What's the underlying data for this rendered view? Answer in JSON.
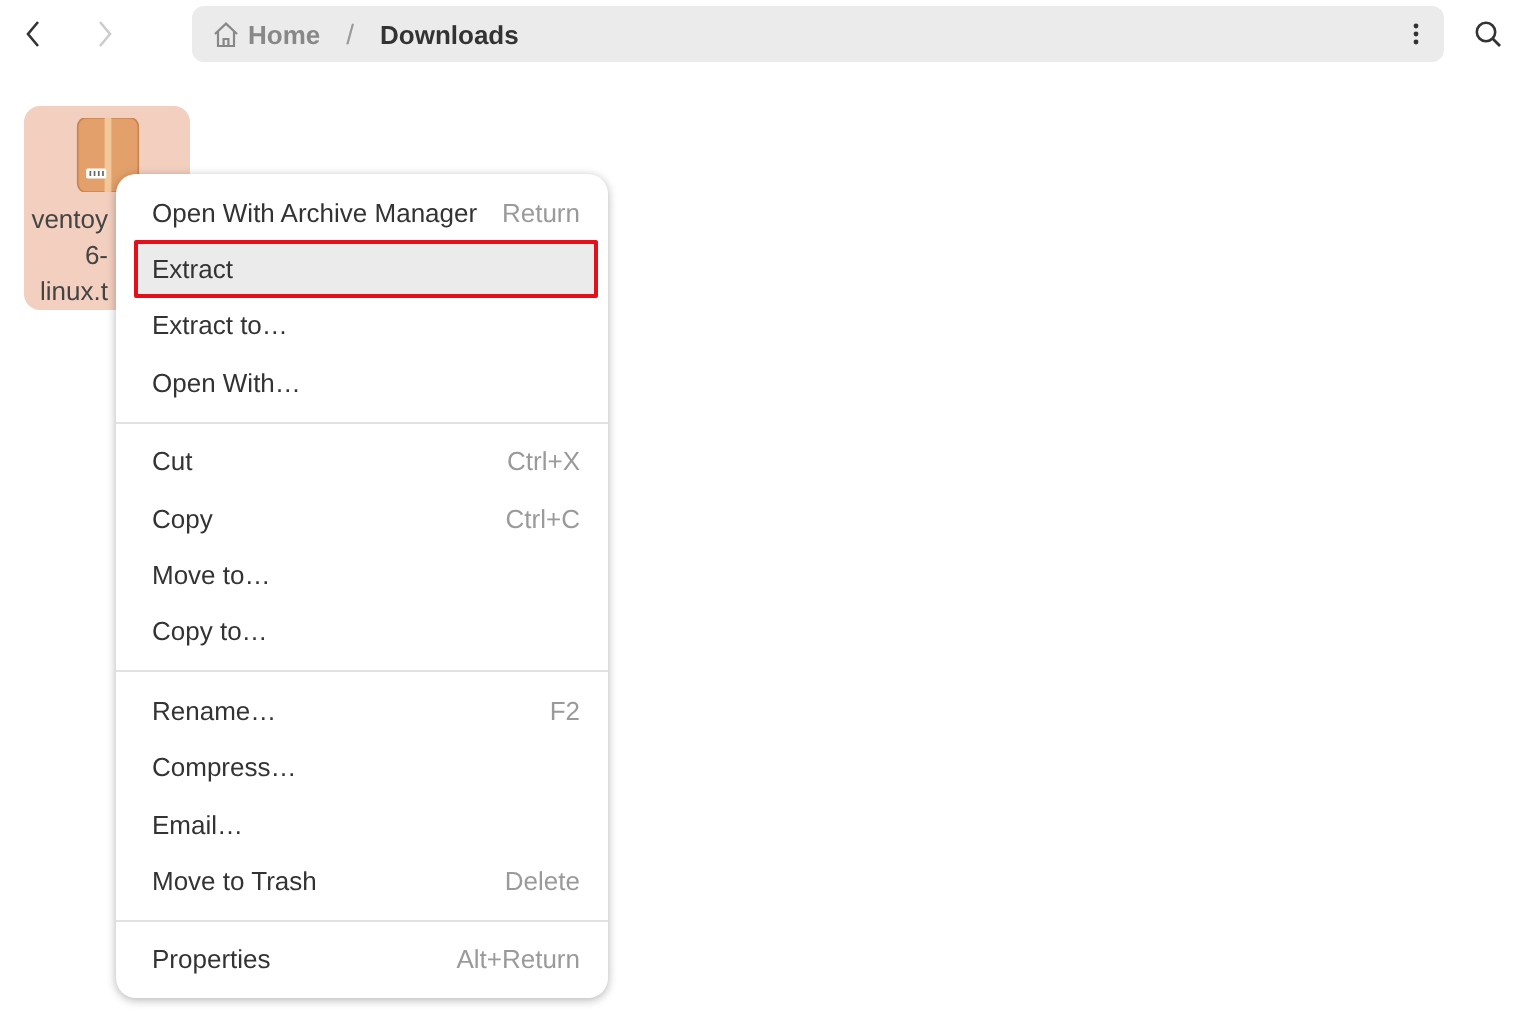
{
  "header": {
    "path": [
      {
        "label": "Home",
        "kind": "home"
      },
      {
        "label": "Downloads",
        "kind": "folder"
      }
    ],
    "separator": "/",
    "back_disabled": false,
    "forward_disabled": true
  },
  "files": [
    {
      "label_lines": [
        "ventoy",
        "6-",
        "linux.t"
      ],
      "selected": true
    }
  ],
  "context_menu": {
    "sections": [
      {
        "items": [
          {
            "label": "Open With Archive Manager",
            "shortcut": "Return",
            "selected": false
          },
          {
            "label": "Extract",
            "selected": true
          },
          {
            "label": "Extract to…",
            "selected": false
          },
          {
            "label": "Open With…",
            "selected": false
          }
        ]
      },
      {
        "items": [
          {
            "label": "Cut",
            "shortcut": "Ctrl+X",
            "selected": false
          },
          {
            "label": "Copy",
            "shortcut": "Ctrl+C",
            "selected": false
          },
          {
            "label": "Move to…",
            "selected": false
          },
          {
            "label": "Copy to…",
            "selected": false
          }
        ]
      },
      {
        "items": [
          {
            "label": "Rename…",
            "shortcut": "F2",
            "selected": false
          },
          {
            "label": "Compress…",
            "selected": false
          },
          {
            "label": "Email…",
            "selected": false
          },
          {
            "label": "Move to Trash",
            "shortcut": "Delete",
            "selected": false
          }
        ]
      },
      {
        "items": [
          {
            "label": "Properties",
            "shortcut": "Alt+Return",
            "selected": false
          }
        ]
      }
    ]
  }
}
